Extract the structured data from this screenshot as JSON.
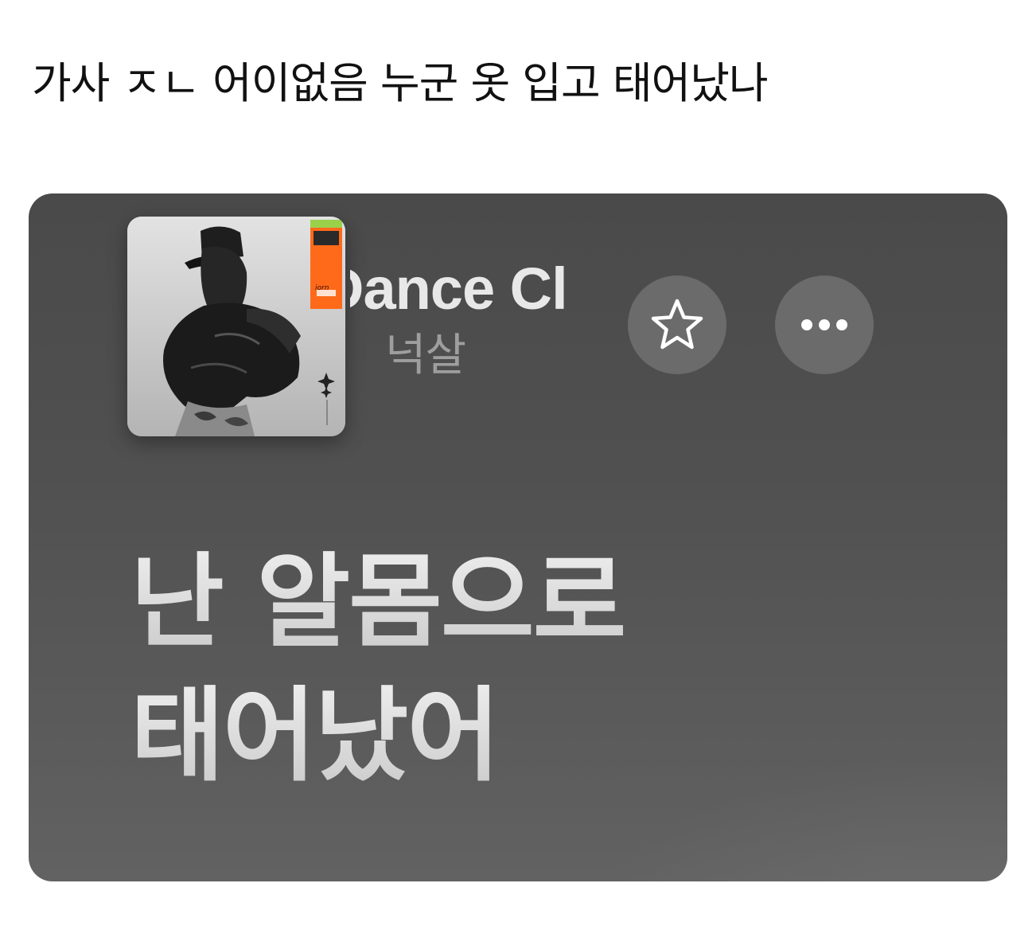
{
  "post": {
    "caption": "가사 ㅈㄴ 어이없음 누군 옷 입고 태어났나"
  },
  "player": {
    "track_title": "Dance Cl",
    "artist": "넉살",
    "album_art": {
      "icon": "album-cover-image",
      "accent_color": "#ff6a1a"
    },
    "favorite_button": {
      "icon": "star-outline-icon",
      "glyph": "☆"
    },
    "more_button": {
      "icon": "ellipsis-icon",
      "glyph": "•••"
    },
    "lyrics": [
      "난 알몸으로",
      "태어났어"
    ]
  },
  "colors": {
    "card_background": "#505050",
    "lyrics_text": "#c9c9c9",
    "title_text": "#e8e8e8",
    "artist_text": "#9e9e9e",
    "button_background": "#6b6b6b"
  }
}
